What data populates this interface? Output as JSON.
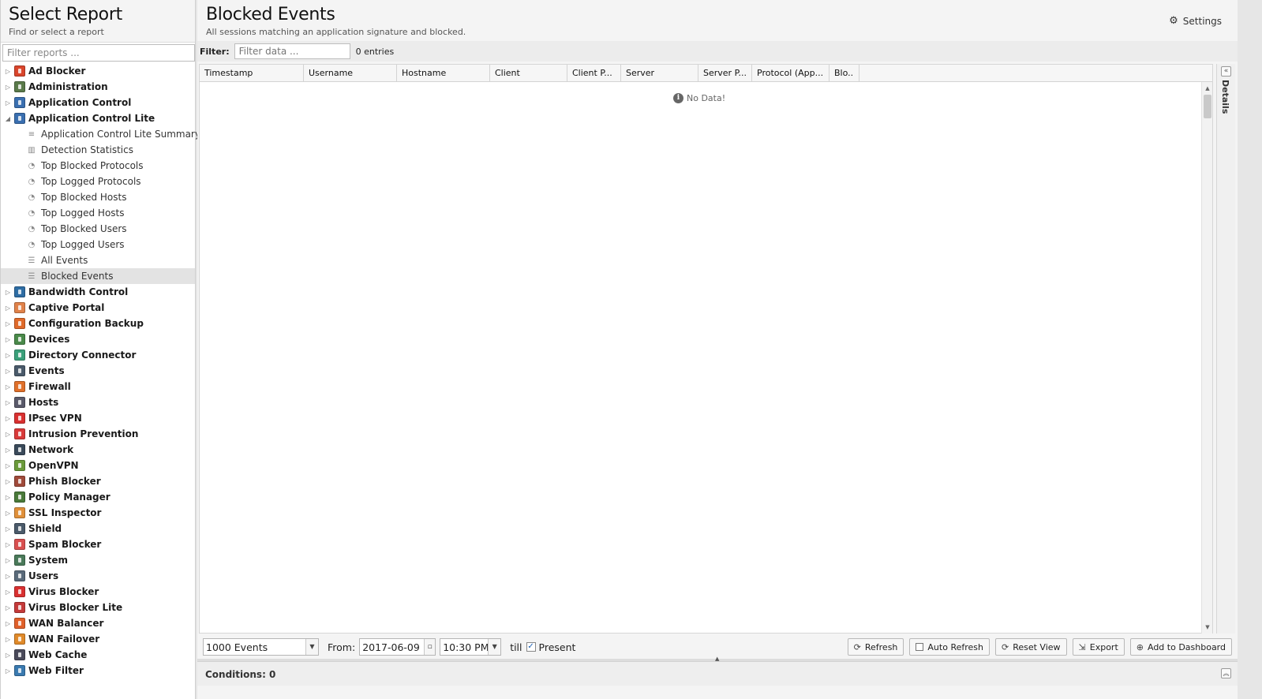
{
  "left": {
    "title": "Select Report",
    "subtitle": "Find or select a report",
    "search_placeholder": "Filter reports ..."
  },
  "tree": [
    {
      "label": "Ad Blocker",
      "type": "app",
      "color": "#d9452b"
    },
    {
      "label": "Administration",
      "type": "app",
      "color": "#5a7a4a"
    },
    {
      "label": "Application Control",
      "type": "app",
      "color": "#3a6fb0"
    },
    {
      "label": "Application Control Lite",
      "type": "app",
      "color": "#3a6fb0",
      "expanded": true
    },
    {
      "label": "Application Control Lite Summary",
      "type": "child",
      "icon": "≡"
    },
    {
      "label": "Detection Statistics",
      "type": "child",
      "icon": "▥"
    },
    {
      "label": "Top Blocked Protocols",
      "type": "child",
      "icon": "◔"
    },
    {
      "label": "Top Logged Protocols",
      "type": "child",
      "icon": "◔"
    },
    {
      "label": "Top Blocked Hosts",
      "type": "child",
      "icon": "◔"
    },
    {
      "label": "Top Logged Hosts",
      "type": "child",
      "icon": "◔"
    },
    {
      "label": "Top Blocked Users",
      "type": "child",
      "icon": "◔"
    },
    {
      "label": "Top Logged Users",
      "type": "child",
      "icon": "◔"
    },
    {
      "label": "All Events",
      "type": "child",
      "icon": "☰"
    },
    {
      "label": "Blocked Events",
      "type": "child",
      "icon": "☰",
      "selected": true
    },
    {
      "label": "Bandwidth Control",
      "type": "app",
      "color": "#2e6da4"
    },
    {
      "label": "Captive Portal",
      "type": "app",
      "color": "#e0824a"
    },
    {
      "label": "Configuration Backup",
      "type": "app",
      "color": "#e06a2a"
    },
    {
      "label": "Devices",
      "type": "app",
      "color": "#4a8a4a"
    },
    {
      "label": "Directory Connector",
      "type": "app",
      "color": "#3aa07a"
    },
    {
      "label": "Events",
      "type": "app",
      "color": "#4a5a6a"
    },
    {
      "label": "Firewall",
      "type": "app",
      "color": "#e0702a"
    },
    {
      "label": "Hosts",
      "type": "app",
      "color": "#5a5a6a"
    },
    {
      "label": "IPsec VPN",
      "type": "app",
      "color": "#d93030"
    },
    {
      "label": "Intrusion Prevention",
      "type": "app",
      "color": "#d93a3a"
    },
    {
      "label": "Network",
      "type": "app",
      "color": "#3a4a5a"
    },
    {
      "label": "OpenVPN",
      "type": "app",
      "color": "#6a9a3a"
    },
    {
      "label": "Phish Blocker",
      "type": "app",
      "color": "#a04a3a"
    },
    {
      "label": "Policy Manager",
      "type": "app",
      "color": "#4a7a3a"
    },
    {
      "label": "SSL Inspector",
      "type": "app",
      "color": "#e0903a"
    },
    {
      "label": "Shield",
      "type": "app",
      "color": "#4a5a6a"
    },
    {
      "label": "Spam Blocker",
      "type": "app",
      "color": "#d95050"
    },
    {
      "label": "System",
      "type": "app",
      "color": "#4a7a5a"
    },
    {
      "label": "Users",
      "type": "app",
      "color": "#5a6a7a"
    },
    {
      "label": "Virus Blocker",
      "type": "app",
      "color": "#d93030"
    },
    {
      "label": "Virus Blocker Lite",
      "type": "app",
      "color": "#c43a3a"
    },
    {
      "label": "WAN Balancer",
      "type": "app",
      "color": "#e0602a"
    },
    {
      "label": "WAN Failover",
      "type": "app",
      "color": "#e08a2a"
    },
    {
      "label": "Web Cache",
      "type": "app",
      "color": "#4a4a5a"
    },
    {
      "label": "Web Filter",
      "type": "app",
      "color": "#3a7ab0"
    }
  ],
  "main": {
    "title": "Blocked Events",
    "subtitle": "All sessions matching an application signature and blocked.",
    "settings_label": "Settings",
    "filter_label": "Filter:",
    "filter_placeholder": "Filter data ...",
    "entries": "0 entries",
    "columns": [
      {
        "label": "Timestamp"
      },
      {
        "label": "Username"
      },
      {
        "label": "Hostname"
      },
      {
        "label": "Client"
      },
      {
        "label": "Client P..."
      },
      {
        "label": "Server"
      },
      {
        "label": "Server P..."
      },
      {
        "label": "Protocol (App..."
      },
      {
        "label": "Blo.."
      }
    ],
    "no_data": "No Data!",
    "details_label": "Details"
  },
  "toolbar": {
    "limit_value": "1000 Events",
    "from_label": "From:",
    "date_value": "2017-06-09",
    "time_value": "10:30 PM",
    "till_label": "till",
    "present_label": "Present",
    "present_checked": true,
    "refresh_label": "Refresh",
    "auto_refresh_label": "Auto Refresh",
    "reset_view_label": "Reset View",
    "export_label": "Export",
    "add_dashboard_label": "Add to Dashboard"
  },
  "conditions": {
    "label": "Conditions: 0"
  }
}
